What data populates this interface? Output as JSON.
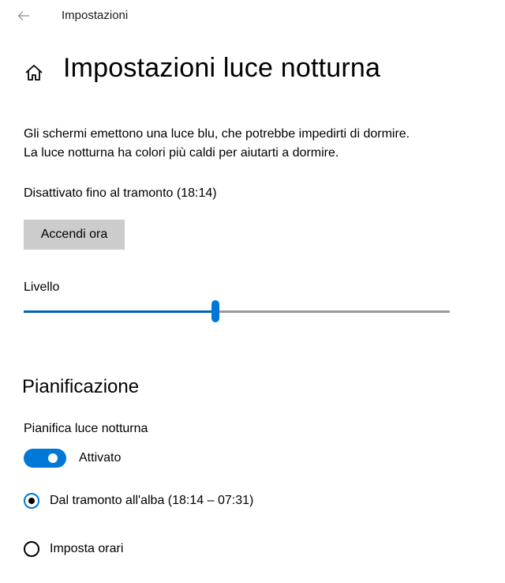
{
  "window": {
    "title": "Impostazioni"
  },
  "header": {
    "title": "Impostazioni luce notturna"
  },
  "description": {
    "line1": "Gli schermi emettono una luce blu, che potrebbe impedirti di dormire.",
    "line2": "La luce notturna ha colori più caldi per aiutarti a dormire."
  },
  "status": {
    "text": "Disattivato fino al tramonto (18:14)"
  },
  "buttons": {
    "turn_on_now": "Accendi ora"
  },
  "level": {
    "label": "Livello",
    "value_fraction": 0.45
  },
  "schedule": {
    "section_title": "Pianificazione",
    "toggle_label_heading": "Pianifica luce notturna",
    "toggle_state": "on",
    "toggle_text": "Attivato",
    "options": [
      {
        "label": "Dal tramonto all'alba (18:14 – 07:31)",
        "selected": true
      },
      {
        "label": "Imposta orari",
        "selected": false
      }
    ]
  },
  "colors": {
    "accent": "#0078d7",
    "button_bg": "#cccccc",
    "track_inactive": "#999999"
  },
  "icons": {
    "back": "back-arrow-icon",
    "home": "home-icon"
  }
}
